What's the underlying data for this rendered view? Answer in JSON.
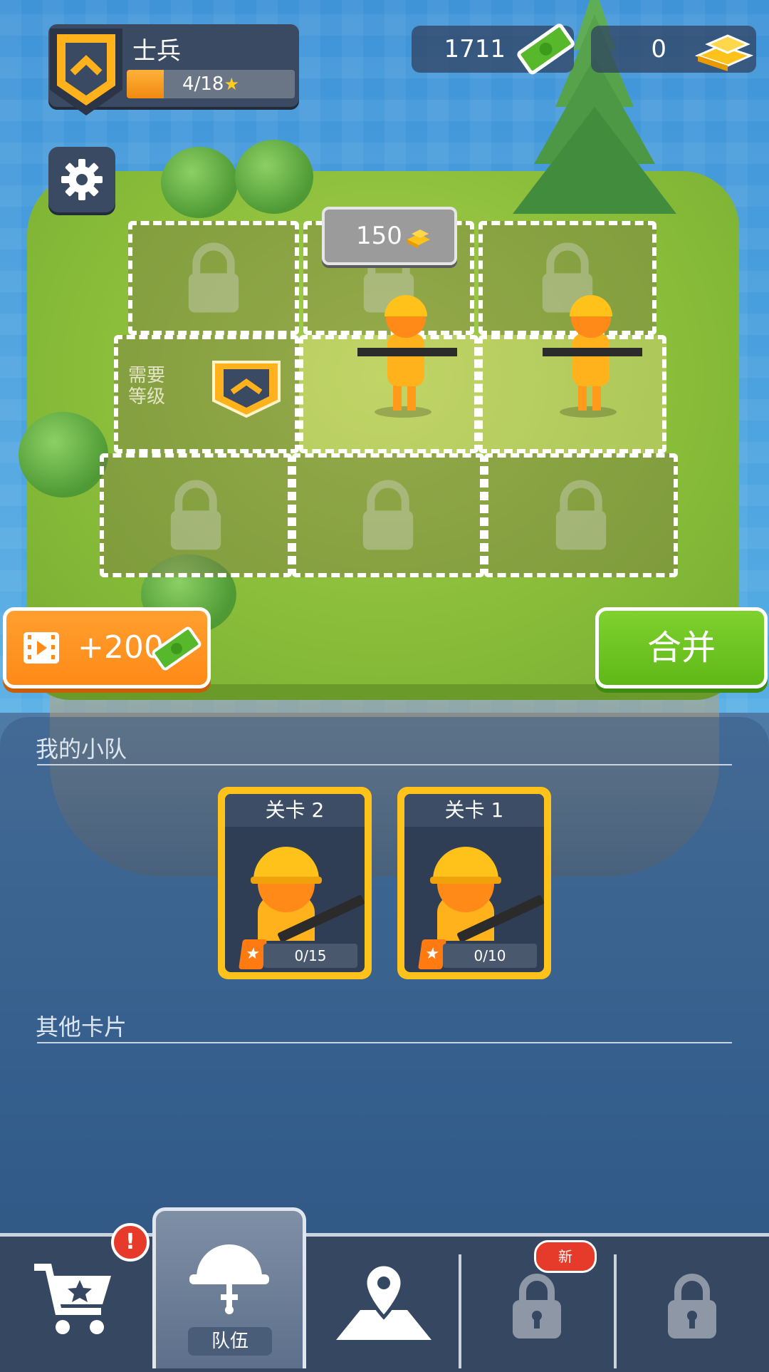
{
  "header": {
    "rank_title": "士兵",
    "xp_text": "4/18",
    "xp_star": "★",
    "xp_progress": 0.22,
    "cash": "1711",
    "gold": "0"
  },
  "board": {
    "unlock_price": "150",
    "requirement_text_line1": "需要",
    "requirement_text_line2": "等级"
  },
  "actions": {
    "ad_reward": "+200",
    "merge_label": "合并"
  },
  "squad": {
    "title": "我的小队",
    "cards": [
      {
        "title": "关卡 2",
        "progress": "0/15"
      },
      {
        "title": "关卡 1",
        "progress": "0/10"
      }
    ],
    "other_title": "其他卡片"
  },
  "nav": {
    "alert_mark": "!",
    "team_label": "队伍",
    "new_badge": "新"
  },
  "colors": {
    "orange": "#ff8a18",
    "green": "#5fb818",
    "gold": "#ffc21a",
    "panel": "#354761"
  }
}
